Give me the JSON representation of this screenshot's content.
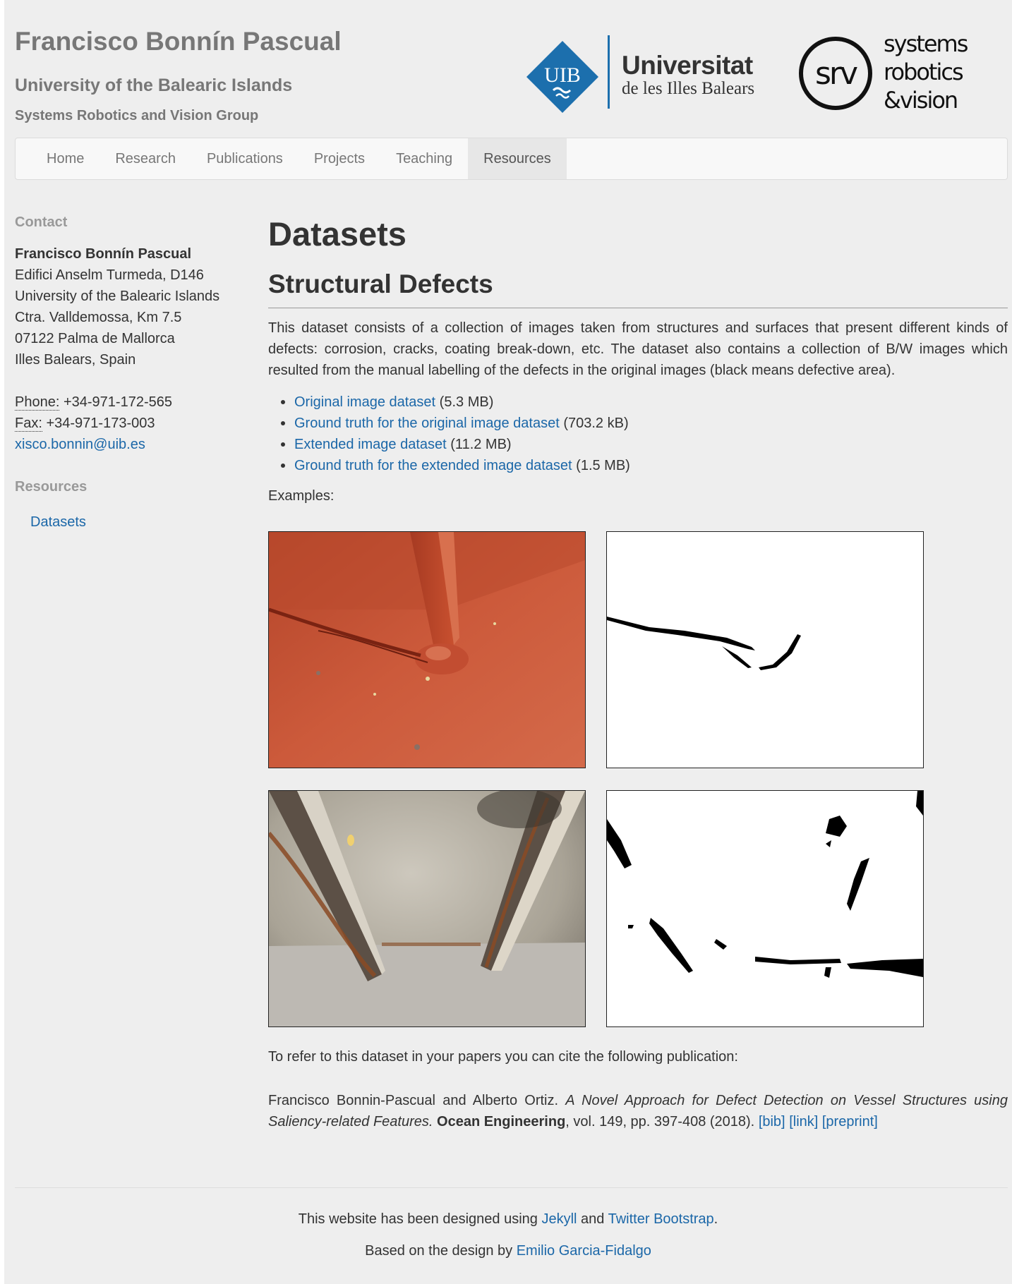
{
  "header": {
    "title": "Francisco Bonnín Pascual",
    "subtitle": "University of the Balearic Islands",
    "group": "Systems Robotics and Vision Group",
    "uib_logo": {
      "mark": "UIB",
      "word1": "Universitat",
      "word2": "de les Illes Balears",
      "color": "#1c6fad"
    },
    "srv_logo": {
      "mark": "srv",
      "line1": "systems",
      "line2": "robotics",
      "line3": "&vision"
    }
  },
  "nav": {
    "items": [
      "Home",
      "Research",
      "Publications",
      "Projects",
      "Teaching",
      "Resources"
    ],
    "active": "Resources"
  },
  "sidebar": {
    "contact_heading": "Contact",
    "name": "Francisco Bonnín Pascual",
    "address": [
      "Edifici Anselm Turmeda, D146",
      "University of the Balearic Islands",
      "Ctra. Valldemossa, Km 7.5",
      "07122 Palma de Mallorca",
      "Illes Balears, Spain"
    ],
    "phone_label": "Phone:",
    "phone": "+34-971-172-565",
    "fax_label": "Fax:",
    "fax": "+34-971-173-003",
    "email": "xisco.bonnin@uib.es",
    "resources_heading": "Resources",
    "resources_link": "Datasets"
  },
  "main": {
    "heading": "Datasets",
    "section_heading": "Structural Defects",
    "description": "This dataset consists of a collection of images taken from structures and surfaces that present different kinds of defects: corrosion, cracks, coating break-down, etc. The dataset also contains a collection of B/W images which resulted from the manual labelling of the defects in the original images (black means defective area).",
    "downloads": [
      {
        "label": "Original image dataset",
        "size": "(5.3 MB)"
      },
      {
        "label": "Ground truth for the original image dataset",
        "size": "(703.2 kB)"
      },
      {
        "label": "Extended image dataset",
        "size": "(11.2 MB)"
      },
      {
        "label": "Ground truth for the extended image dataset",
        "size": "(1.5 MB)"
      }
    ],
    "examples_label": "Examples:",
    "cite_intro": "To refer to this dataset in your papers you can cite the following publication:",
    "citation": {
      "authors": "Francisco Bonnin-Pascual and Alberto Ortiz.",
      "title": "A Novel Approach for Defect Detection on Vessel Structures using Saliency-related Features.",
      "journal": "Ocean Engineering",
      "details": ", vol. 149, pp. 397-408 (2018).",
      "links": [
        "[bib]",
        "[link]",
        "[preprint]"
      ]
    }
  },
  "footer": {
    "line1_prefix": "This website has been designed using",
    "link_jekyll": "Jekyll",
    "line1_and": "and",
    "link_bootstrap": "Twitter Bootstrap",
    "line1_suffix": ".",
    "line2_prefix": "Based on the design by",
    "link_designer": "Emilio Garcia-Fidalgo"
  },
  "colors": {
    "link": "#1b67a8",
    "page_bg": "#eeeeee",
    "muted": "#777777",
    "uib_blue": "#1c6fad"
  }
}
